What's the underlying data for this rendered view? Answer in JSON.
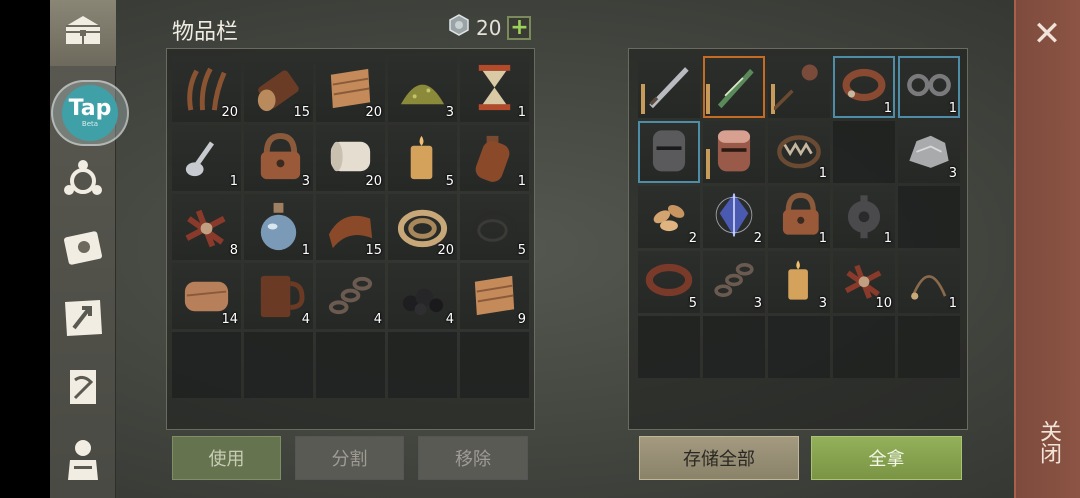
{
  "inventory_title": "物品栏",
  "currency": {
    "amount": "20",
    "icon": "gem-icon",
    "add_label": "+"
  },
  "tap_badge": {
    "brand": "Tap",
    "tag": "Beta"
  },
  "sidebar": [
    "chest-icon",
    "crafting-icon",
    "journal-icon",
    "map-icon",
    "quest-scroll-icon",
    "character-icon"
  ],
  "inventory": {
    "rows": [
      [
        {
          "item": "kelp",
          "count": "20"
        },
        {
          "item": "log",
          "count": "15"
        },
        {
          "item": "cloth",
          "count": "20"
        },
        {
          "item": "powder",
          "count": "3"
        },
        {
          "item": "hourglass",
          "count": "1"
        }
      ],
      [
        {
          "item": "spoon",
          "count": "1"
        },
        {
          "item": "padlock",
          "count": "3"
        },
        {
          "item": "paper-roll",
          "count": "20"
        },
        {
          "item": "candle",
          "count": "5"
        },
        {
          "item": "leather-flask",
          "count": "1"
        }
      ],
      [
        {
          "item": "bone-pile",
          "count": "8"
        },
        {
          "item": "potion",
          "count": "1"
        },
        {
          "item": "leather-roll",
          "count": "15"
        },
        {
          "item": "rope",
          "count": "20"
        },
        {
          "item": "wire",
          "count": "5"
        }
      ],
      [
        {
          "item": "leather",
          "count": "14"
        },
        {
          "item": "mug",
          "count": "4"
        },
        {
          "item": "chain",
          "count": "4"
        },
        {
          "item": "coal",
          "count": "4"
        },
        {
          "item": "cloth",
          "count": "9"
        }
      ],
      [
        {
          "item": "",
          "count": ""
        },
        {
          "item": "",
          "count": ""
        },
        {
          "item": "",
          "count": ""
        },
        {
          "item": "",
          "count": ""
        },
        {
          "item": "",
          "count": ""
        }
      ]
    ]
  },
  "buttons": {
    "use": "使用",
    "split": "分割",
    "remove": "移除",
    "store_all": "存储全部",
    "take_all": "全拿"
  },
  "storage": {
    "rows": [
      [
        {
          "item": "sword",
          "count": ""
        },
        {
          "item": "green-blade",
          "count": ""
        },
        {
          "item": "mace",
          "count": ""
        },
        {
          "item": "collar",
          "count": "1"
        },
        {
          "item": "shackles",
          "count": "1"
        }
      ],
      [
        {
          "item": "iron-helmet",
          "count": ""
        },
        {
          "item": "copper-helmet",
          "count": ""
        },
        {
          "item": "bear-trap",
          "count": "1"
        },
        {
          "item": "",
          "count": ""
        },
        {
          "item": "ore",
          "count": "3"
        }
      ],
      [
        {
          "item": "seeds",
          "count": "2"
        },
        {
          "item": "crystal",
          "count": "2"
        },
        {
          "item": "padlock",
          "count": "1"
        },
        {
          "item": "gear",
          "count": "1"
        },
        {
          "item": "",
          "count": ""
        }
      ],
      [
        {
          "item": "leather-strap",
          "count": "5"
        },
        {
          "item": "chain",
          "count": "3"
        },
        {
          "item": "candle",
          "count": "3"
        },
        {
          "item": "bone-pile",
          "count": "10"
        },
        {
          "item": "cord",
          "count": "1"
        }
      ],
      [
        {
          "item": "",
          "count": ""
        },
        {
          "item": "",
          "count": ""
        },
        {
          "item": "",
          "count": ""
        },
        {
          "item": "",
          "count": ""
        },
        {
          "item": "",
          "count": ""
        }
      ]
    ]
  },
  "close": {
    "icon": "close-icon",
    "label": "关闭"
  }
}
